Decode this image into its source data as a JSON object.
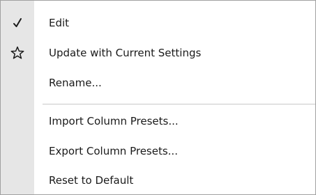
{
  "menu": {
    "items": [
      {
        "label": "Edit",
        "icon": "checkmark-icon",
        "checked": true
      },
      {
        "label": "Update with Current Settings",
        "icon": "star-outline-icon"
      },
      {
        "label": "Rename..."
      },
      {
        "label": "Import Column Presets..."
      },
      {
        "label": "Export Column Presets..."
      },
      {
        "label": "Reset to Default"
      }
    ],
    "icons": {
      "check_glyph": "✓"
    },
    "colors": {
      "gutter": "#e6e6e6",
      "text": "#1a1a1a",
      "separator": "#c8c8c8",
      "border": "#a0a0a0"
    }
  }
}
